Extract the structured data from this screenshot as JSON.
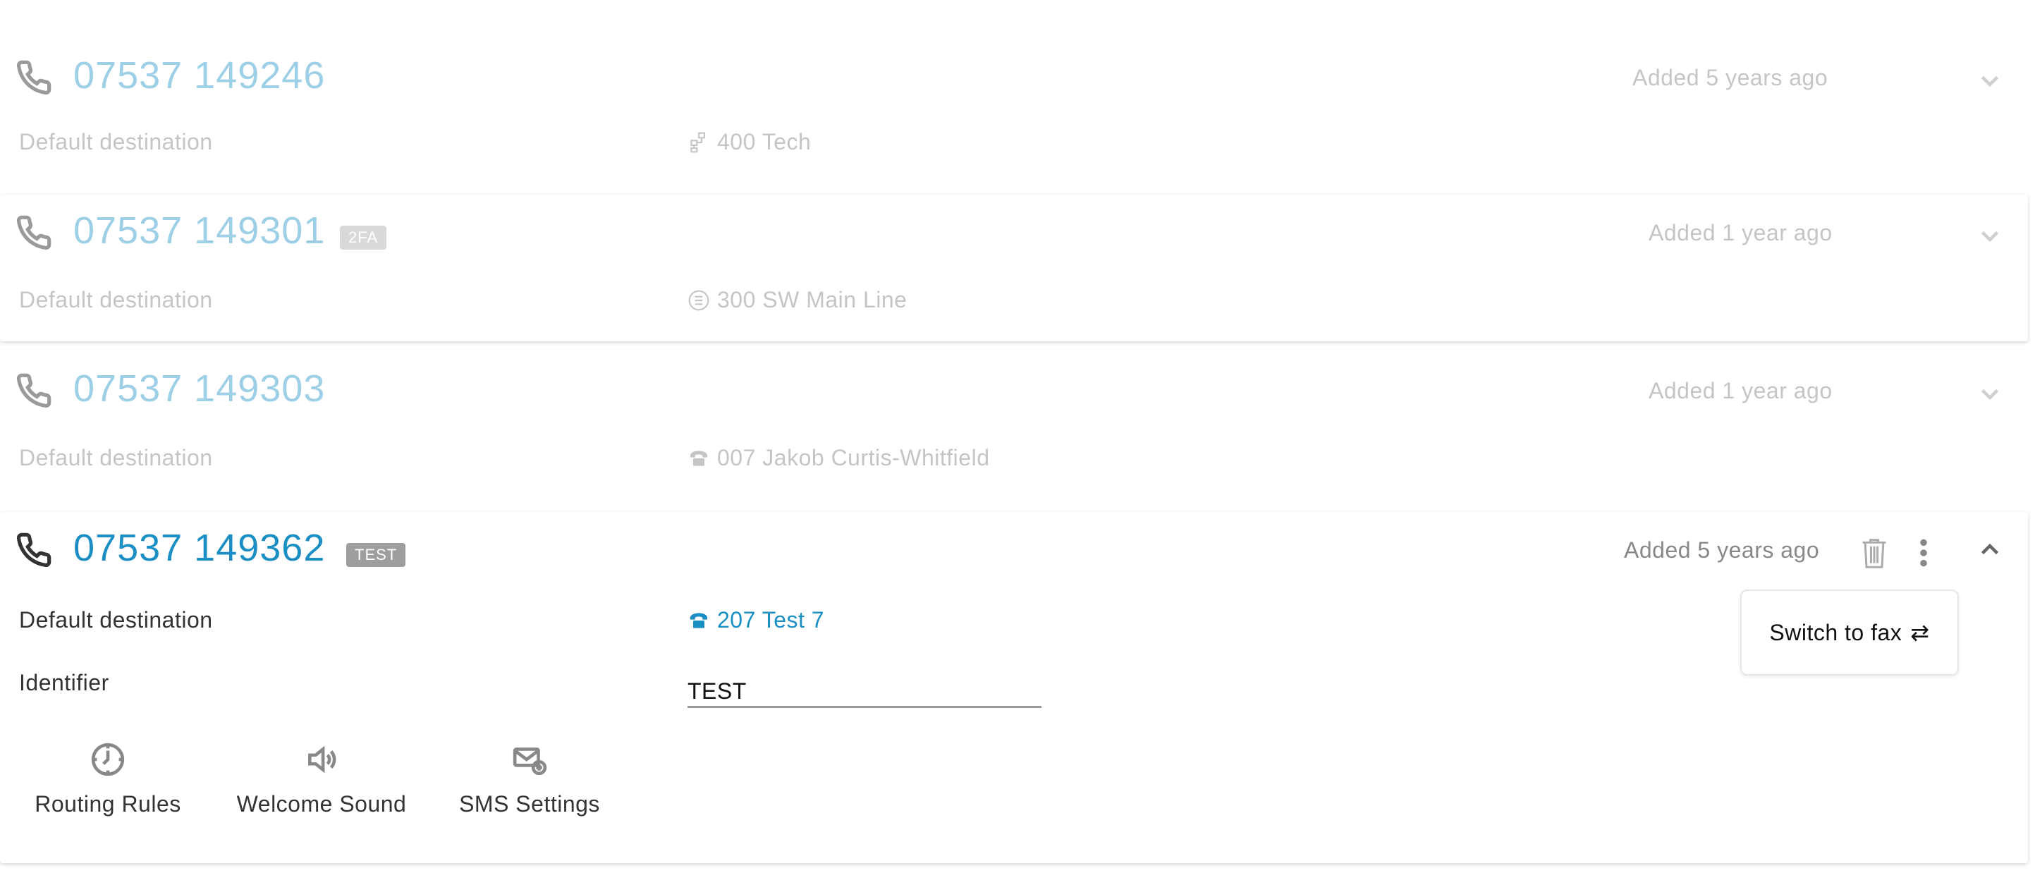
{
  "numbers": [
    {
      "number": "07537 149246",
      "tag": "",
      "added": "Added 5 years ago",
      "destination_label": "Default destination",
      "destination": "400 Tech",
      "destination_icon": "org-chart-icon"
    },
    {
      "number": "07537 149301",
      "tag": "2FA",
      "added": "Added 1 year ago",
      "destination_label": "Default destination",
      "destination": "300 SW Main Line",
      "destination_icon": "list-icon"
    },
    {
      "number": "07537 149303",
      "tag": "",
      "added": "Added 1 year ago",
      "destination_label": "Default destination",
      "destination": "007 Jakob Curtis-Whitfield",
      "destination_icon": "telephone-icon"
    },
    {
      "number": "07537 149362",
      "tag": "TEST",
      "added": "Added 5 years ago",
      "destination_label": "Default destination",
      "destination": "207 Test 7",
      "destination_icon": "telephone-icon",
      "identifier_label": "Identifier",
      "identifier_value": "TEST",
      "actions": [
        {
          "label": "Routing Rules",
          "icon": "clock-icon"
        },
        {
          "label": "Welcome Sound",
          "icon": "speaker-icon"
        },
        {
          "label": "SMS Settings",
          "icon": "envelope-plus-icon"
        }
      ],
      "menu": {
        "switch_label": "Switch to fax",
        "switch_icon": "⇄"
      }
    }
  ],
  "colors": {
    "accent": "#1b8ec4",
    "accent_faded": "#9dcfe6",
    "muted_text": "#c5c5c5",
    "tag_light": "#d9d9d9",
    "tag_dark": "#9e9e9e"
  }
}
